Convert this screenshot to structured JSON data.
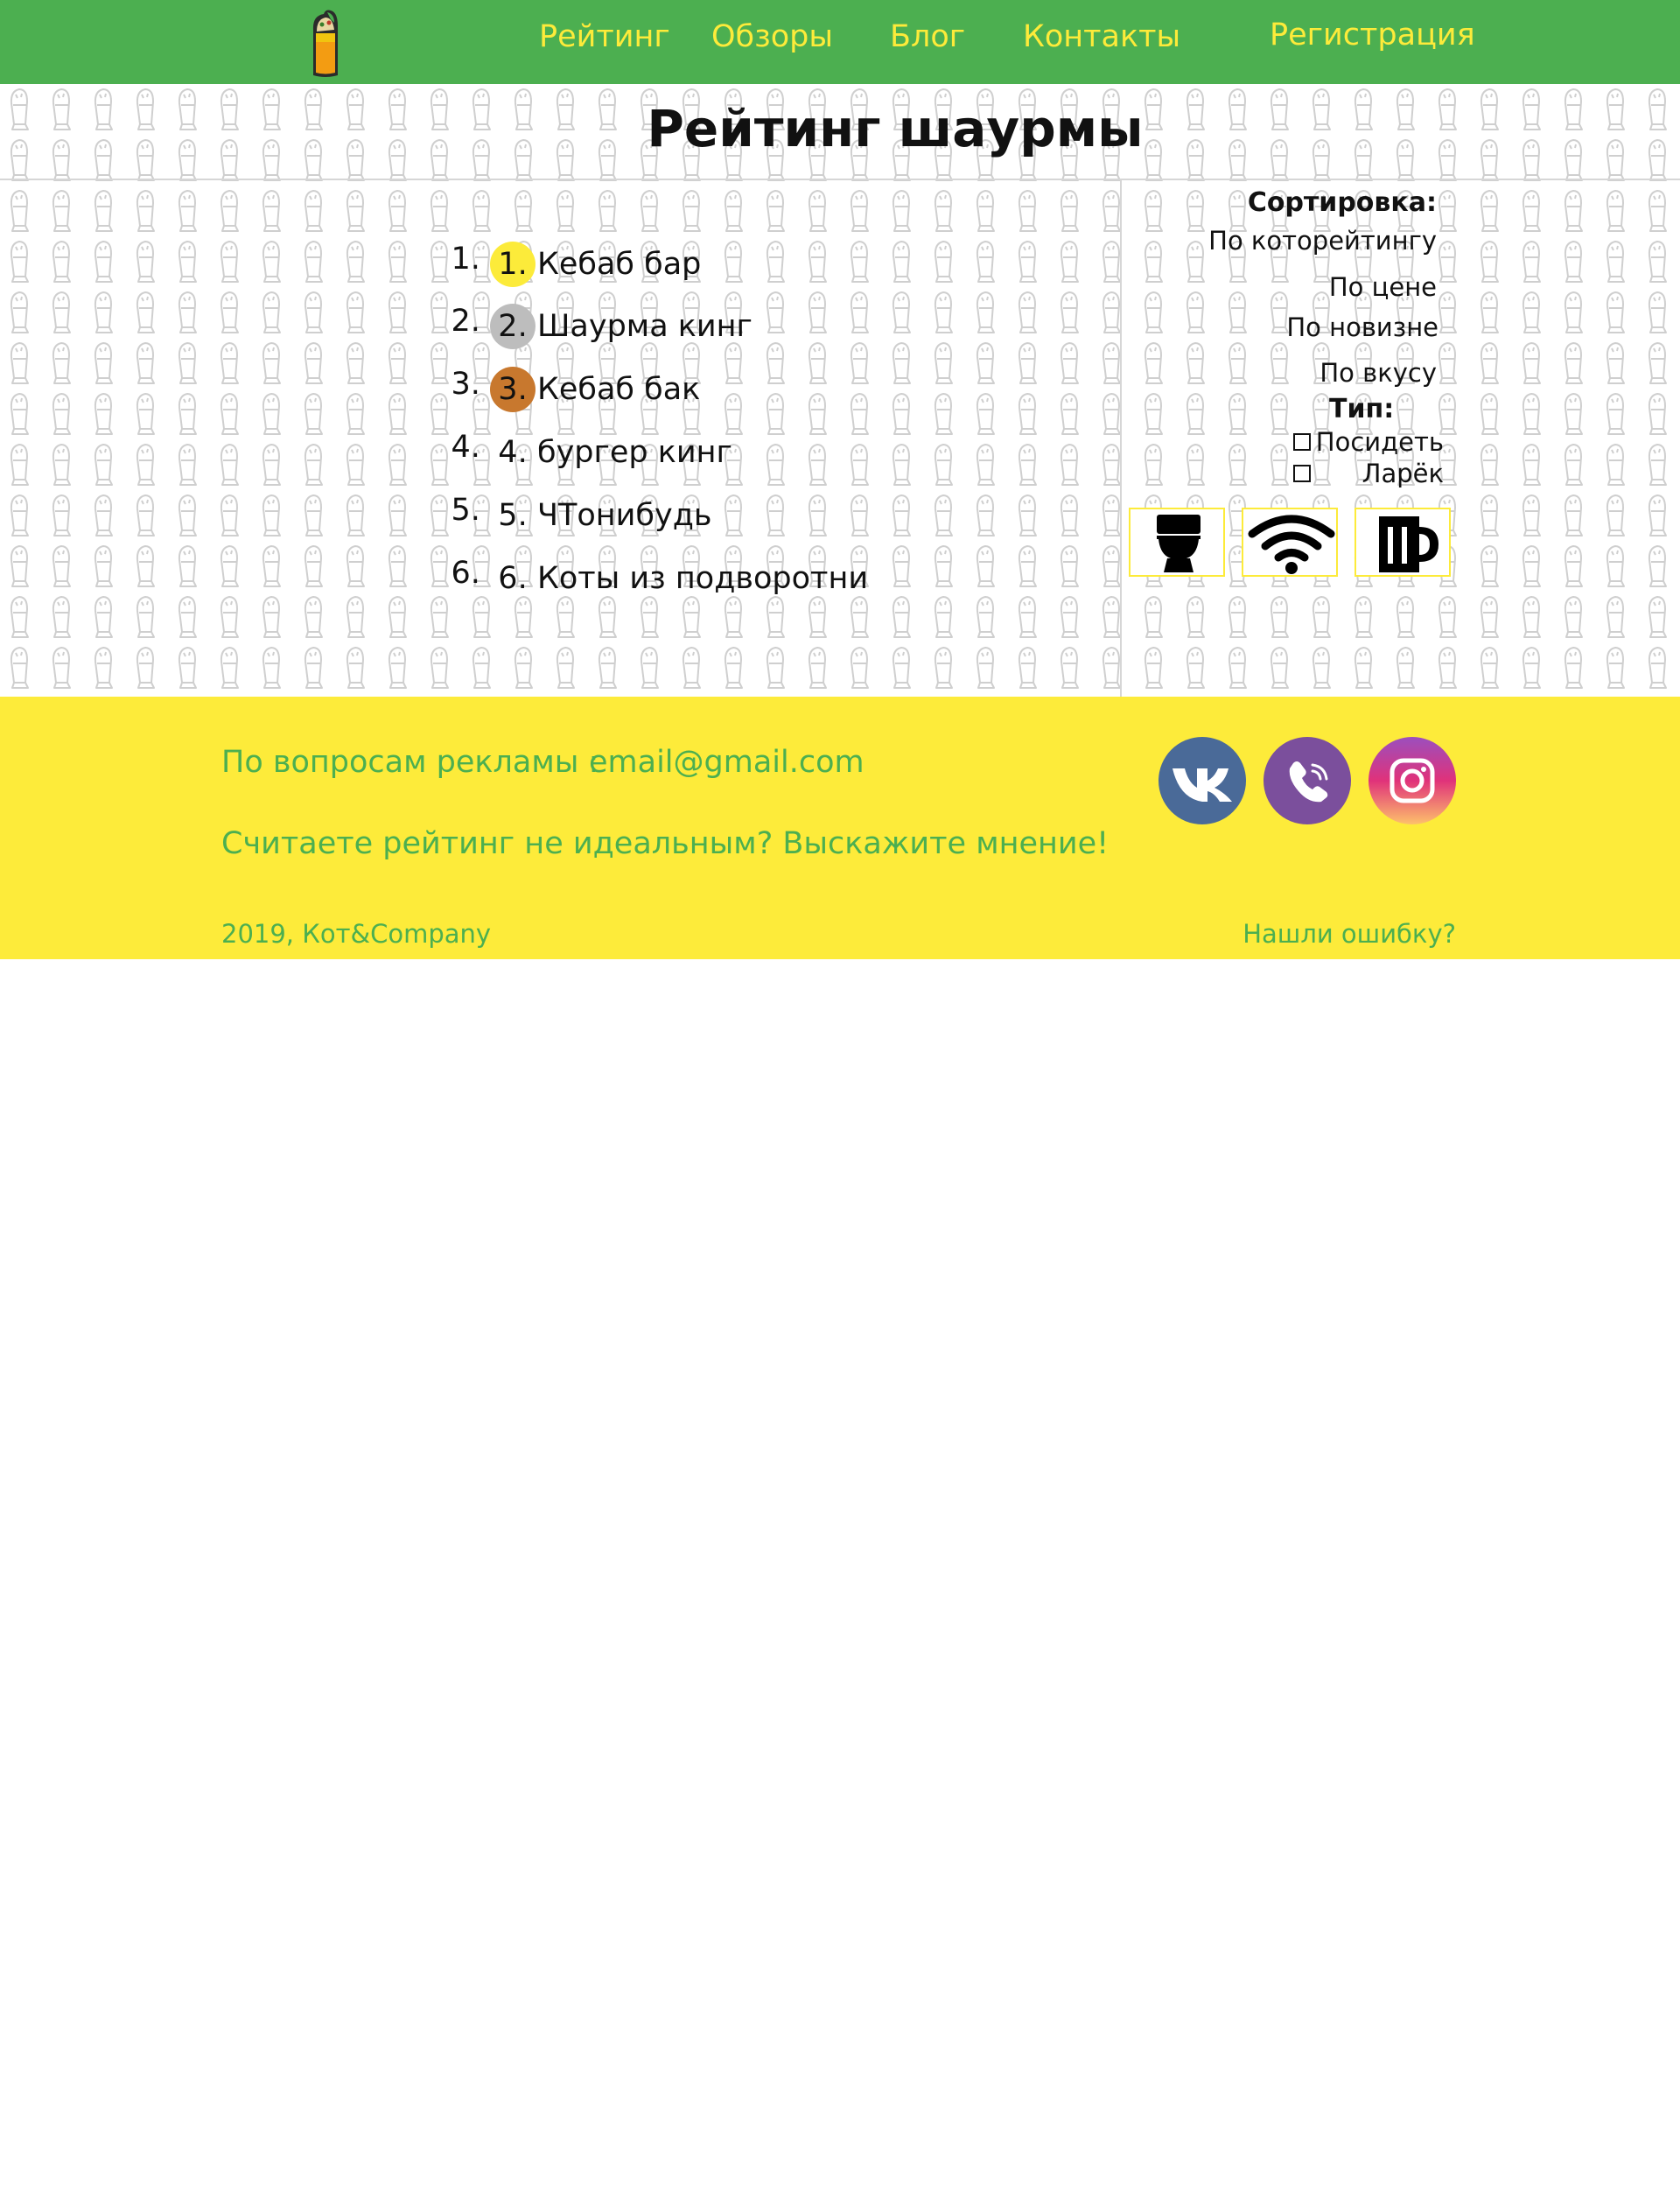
{
  "header": {
    "logo_icon": "shawarma-logo-icon",
    "nav": [
      {
        "label": "Рейтинг"
      },
      {
        "label": "Обзоры"
      },
      {
        "label": "Блог"
      },
      {
        "label": "Контакты"
      }
    ],
    "register_label": "Регистрация",
    "colors": {
      "background": "#4caf50",
      "link": "#fdeb3a"
    }
  },
  "page": {
    "title": "Рейтинг шаурмы",
    "background_pattern_icon": "shawarma-outline-icon"
  },
  "ranking": [
    {
      "number": "1.",
      "name": "Кебаб бар",
      "medal": "gold"
    },
    {
      "number": "2.",
      "name": "Шаурма кинг",
      "medal": "silver"
    },
    {
      "number": "3.",
      "name": "Кебаб бак",
      "medal": "bronze"
    },
    {
      "number": "4.",
      "name": "бургер кинг",
      "medal": "none"
    },
    {
      "number": "5.",
      "name": "ЧТонибудь",
      "medal": "none"
    },
    {
      "number": "6.",
      "name": "Коты из подворотни",
      "medal": "none"
    }
  ],
  "sidebar": {
    "sort_heading": "Сортировка:",
    "sort_options": [
      {
        "label": "По которейтингу"
      },
      {
        "label": "По цене"
      },
      {
        "label": "По новизне"
      },
      {
        "label": "По вкусу"
      }
    ],
    "type_heading": "Тип:",
    "type_options": [
      {
        "label": "Посидеть",
        "checked": false
      },
      {
        "label": "Ларёк",
        "checked": false
      }
    ],
    "features": [
      {
        "icon": "toilet-icon"
      },
      {
        "icon": "wifi-icon"
      },
      {
        "icon": "beer-mug-icon"
      }
    ]
  },
  "footer": {
    "ad_label": "По вопросам рекламы :",
    "ad_email": "email@gmail.com",
    "feedback": "Считаете рейтинг не идеальным? Выскажите мнение!",
    "copyright": "2019, Кот&Company",
    "report_error": "Нашли ошибку?",
    "social": [
      {
        "icon": "vk-icon",
        "color": "#4a6a98"
      },
      {
        "icon": "viber-icon",
        "color": "#7b4f9c"
      },
      {
        "icon": "instagram-icon",
        "color": "#e0327a"
      }
    ],
    "colors": {
      "background": "#fdeb3a",
      "text": "#4caf50"
    }
  }
}
